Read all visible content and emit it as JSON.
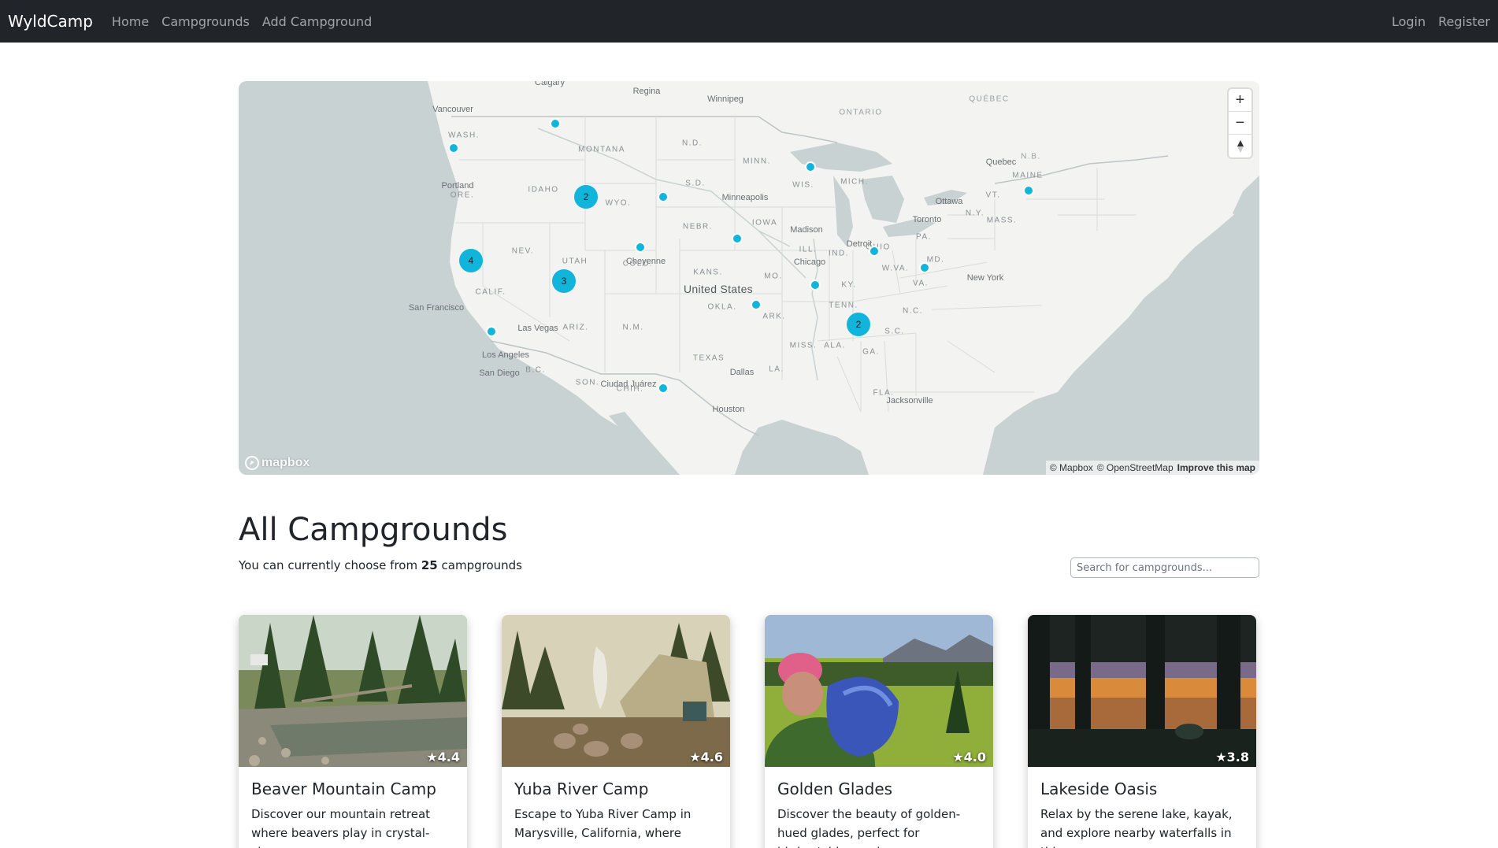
{
  "nav": {
    "brand": "WyldCamp",
    "links": [
      "Home",
      "Campgrounds",
      "Add Campground"
    ],
    "login": "Login",
    "register": "Register"
  },
  "map": {
    "countries": [
      "United States"
    ],
    "provinces": [
      "ONTARIO",
      "QUÉBEC",
      "N.B."
    ],
    "states": [
      "WASH.",
      "ORE.",
      "IDAHO",
      "MONTANA",
      "WYO.",
      "N.D.",
      "S.D.",
      "NEBR.",
      "IOWA",
      "MINN.",
      "WIS.",
      "MICH.",
      "ILL.",
      "IND.",
      "OHIO",
      "PA.",
      "N.Y.",
      "VT.",
      "MAINE",
      "MASS.",
      "NEV.",
      "UTAH",
      "COLO.",
      "KANS.",
      "MO.",
      "KY.",
      "W.VA.",
      "VA.",
      "MD.",
      "CALIF.",
      "ARIZ.",
      "N.M.",
      "OKLA.",
      "ARK.",
      "TENN.",
      "N.C.",
      "S.C.",
      "TEXAS",
      "MISS.",
      "ALA.",
      "GA.",
      "LA.",
      "FLA.",
      "SON.",
      "CHIH.",
      "B.C."
    ],
    "cities": [
      "Calgary",
      "Regina",
      "Winnipeg",
      "Vancouver",
      "Portland",
      "Minneapolis",
      "Ottawa",
      "Quebec",
      "Toronto",
      "Madison",
      "Detroit",
      "Chicago",
      "Cheyenne",
      "New York",
      "San Francisco",
      "Las Vegas",
      "Los Angeles",
      "San Diego",
      "Dallas",
      "Ciudad Juárez",
      "Houston",
      "Jacksonville"
    ],
    "clusters": [
      {
        "label": "2",
        "count": 2
      },
      {
        "label": "4",
        "count": 4
      },
      {
        "label": "3",
        "count": 3
      },
      {
        "label": "2",
        "count": 2
      }
    ],
    "controls": {
      "zoom_in": "+",
      "zoom_out": "−",
      "compass": "▲"
    },
    "logo": "mapbox",
    "attribution": [
      "© Mapbox",
      "© OpenStreetMap",
      "Improve this map"
    ]
  },
  "main": {
    "title": "All Campgrounds",
    "subtitle_prefix": "You can currently choose from",
    "count": "25",
    "subtitle_suffix": "campgrounds",
    "search_placeholder": "Search for campgrounds..."
  },
  "campgrounds": [
    {
      "name": "Beaver Mountain Camp",
      "rating": "★4.4",
      "description": "Discover our mountain retreat where beavers play in crystal-clear"
    },
    {
      "name": "Yuba River Camp",
      "rating": "★4.6",
      "description": "Escape to Yuba River Camp in Marysville, California, where"
    },
    {
      "name": "Golden Glades",
      "rating": "★4.0",
      "description": "Discover the beauty of golden-hued glades, perfect for birdwatching and"
    },
    {
      "name": "Lakeside Oasis",
      "rating": "★3.8",
      "description": "Relax by the serene lake, kayak, and explore nearby waterfalls in this"
    }
  ],
  "colors": {
    "navbar": "#212529",
    "marker": "#11b4da",
    "land": "#f3f3f1",
    "water": "#c9d2d3"
  }
}
